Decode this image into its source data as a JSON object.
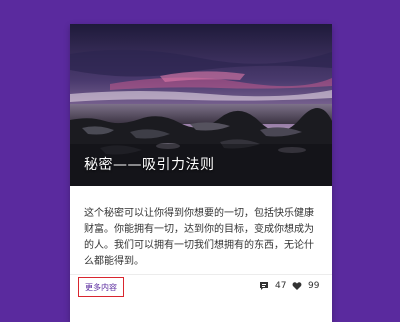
{
  "card": {
    "title": "秘密——吸引力法则",
    "description": "这个秘密可以让你得到你想要的一切，包括快乐健康财富。你能拥有一切，达到你的目标，变成你想成为的人。我们可以拥有一切我们想拥有的东西，无论什么都能得到。",
    "more_label": "更多内容",
    "comment_icon": "comment-icon",
    "comment_count": "47",
    "like_icon": "heart-icon",
    "like_count": "99"
  },
  "colors": {
    "background": "#5a2a9e",
    "accent": "#5a2a9e",
    "button_border": "#d9262e"
  }
}
